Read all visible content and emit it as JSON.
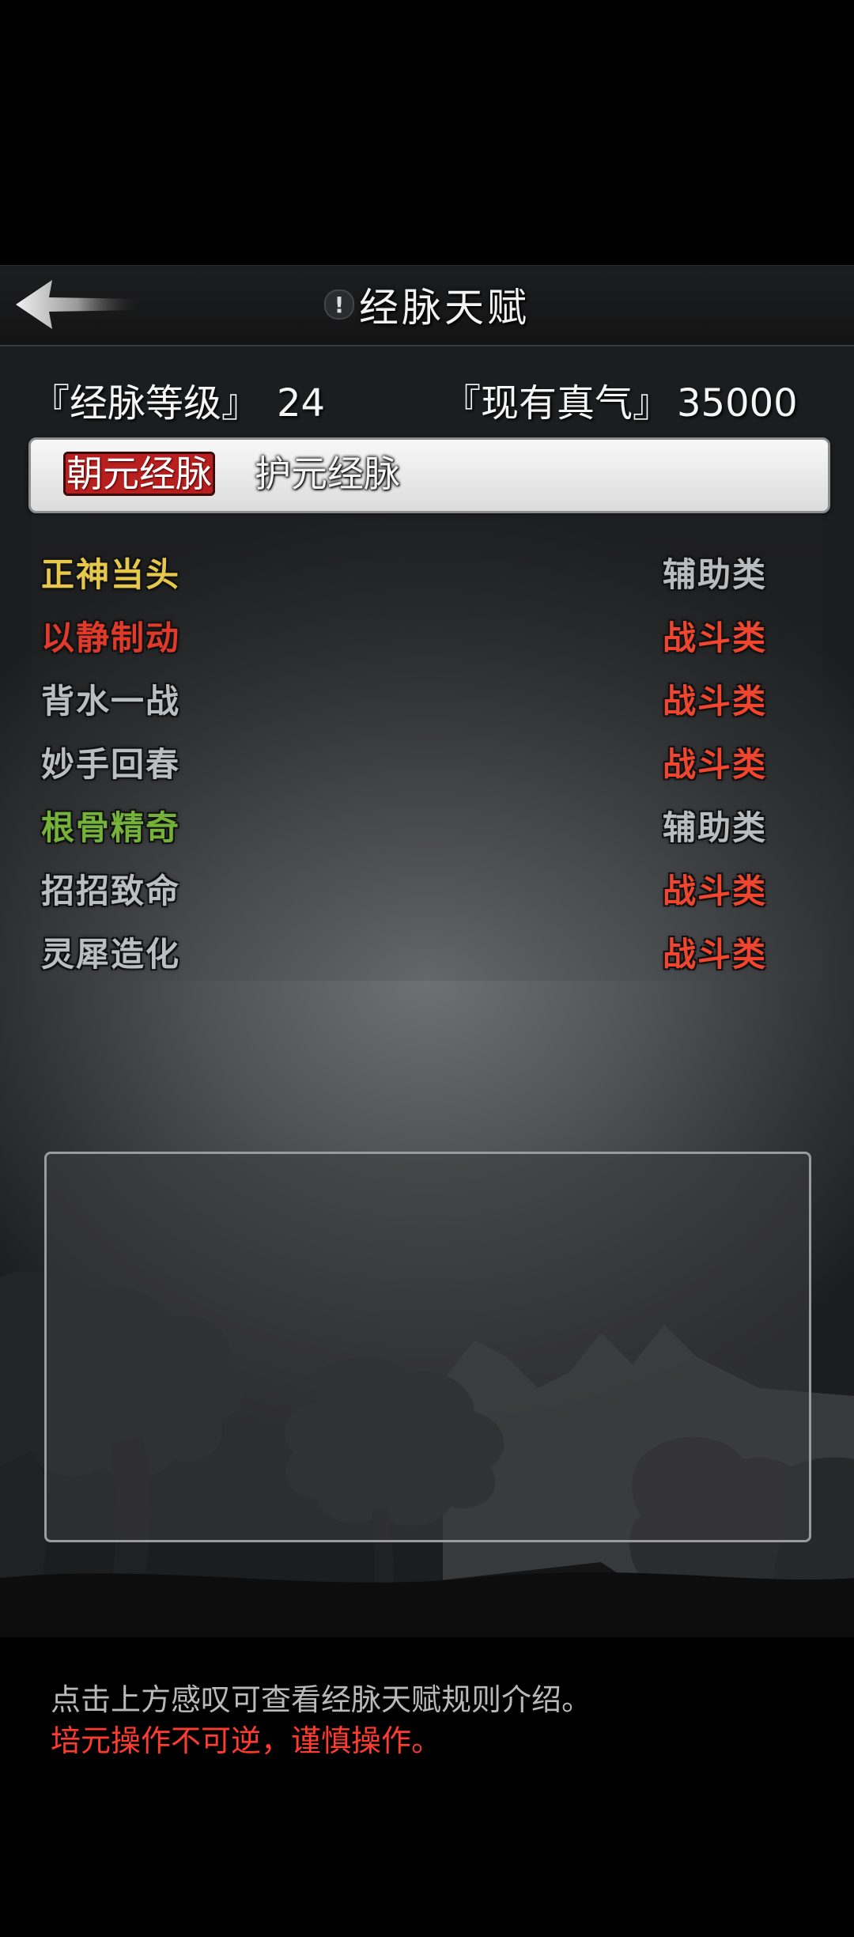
{
  "header": {
    "title": "经脉天赋",
    "info_icon_glyph": "!",
    "back_icon": "arrow-left-icon"
  },
  "stats": {
    "level_label": "『经脉等级』",
    "level_value": "24",
    "qi_label": "『现有真气』",
    "qi_value": "35000"
  },
  "tabs": [
    {
      "label": "朝元经脉",
      "selected": true
    },
    {
      "label": "护元经脉",
      "selected": false
    }
  ],
  "talents": [
    {
      "name": "正神当头",
      "category": "辅助类",
      "name_color": "#e6c84a",
      "category_color": "#b7bcc0"
    },
    {
      "name": "以静制动",
      "category": "战斗类",
      "name_color": "#e23a2a",
      "category_color": "#f0462f"
    },
    {
      "name": "背水一战",
      "category": "战斗类",
      "name_color": "#b9bec2",
      "category_color": "#f0462f"
    },
    {
      "name": "妙手回春",
      "category": "战斗类",
      "name_color": "#b9bec2",
      "category_color": "#f0462f"
    },
    {
      "name": "根骨精奇",
      "category": "辅助类",
      "name_color": "#74b23a",
      "category_color": "#b7bcc0"
    },
    {
      "name": "招招致命",
      "category": "战斗类",
      "name_color": "#b9bec2",
      "category_color": "#f0462f"
    },
    {
      "name": "灵犀造化",
      "category": "战斗类",
      "name_color": "#b9bec2",
      "category_color": "#f0462f"
    }
  ],
  "footer": {
    "note_info": "点击上方感叹可查看经脉天赋规则介绍。",
    "note_warning": "培元操作不可逆，谨慎操作。"
  }
}
